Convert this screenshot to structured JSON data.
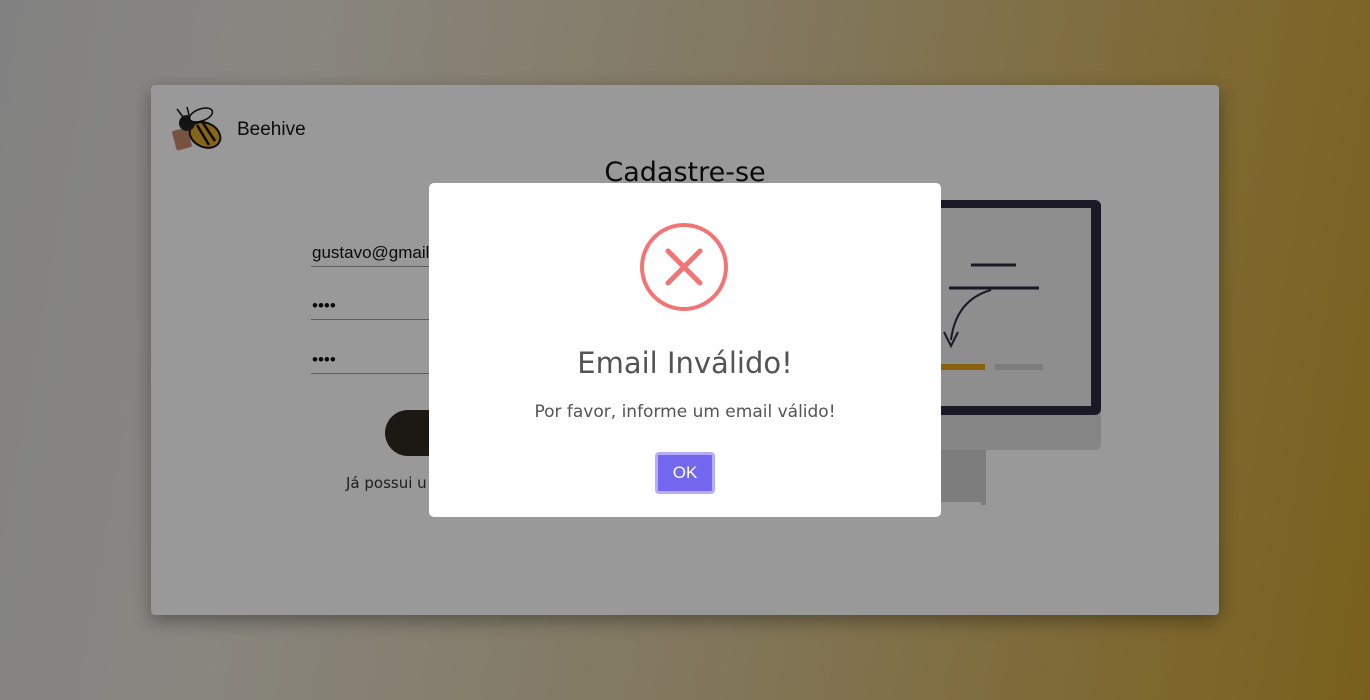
{
  "brand": {
    "name": "Beehive",
    "logo_icon": "bee-logo-icon"
  },
  "form": {
    "title": "Cadastre-se",
    "email_value": "gustavo@gmail",
    "password_value": "••••",
    "confirm_password_value": "••••",
    "submit_label": "",
    "login_prompt": "Já possui u"
  },
  "modal": {
    "icon": "error-x-icon",
    "title": "Email Inválido!",
    "message": "Por favor, informe um email válido!",
    "ok_label": "OK"
  },
  "colors": {
    "modal_button": "#7367f0",
    "error_icon": "#f27474",
    "dark_button": "#2f2a24",
    "accent_orange": "#e3a21a"
  }
}
